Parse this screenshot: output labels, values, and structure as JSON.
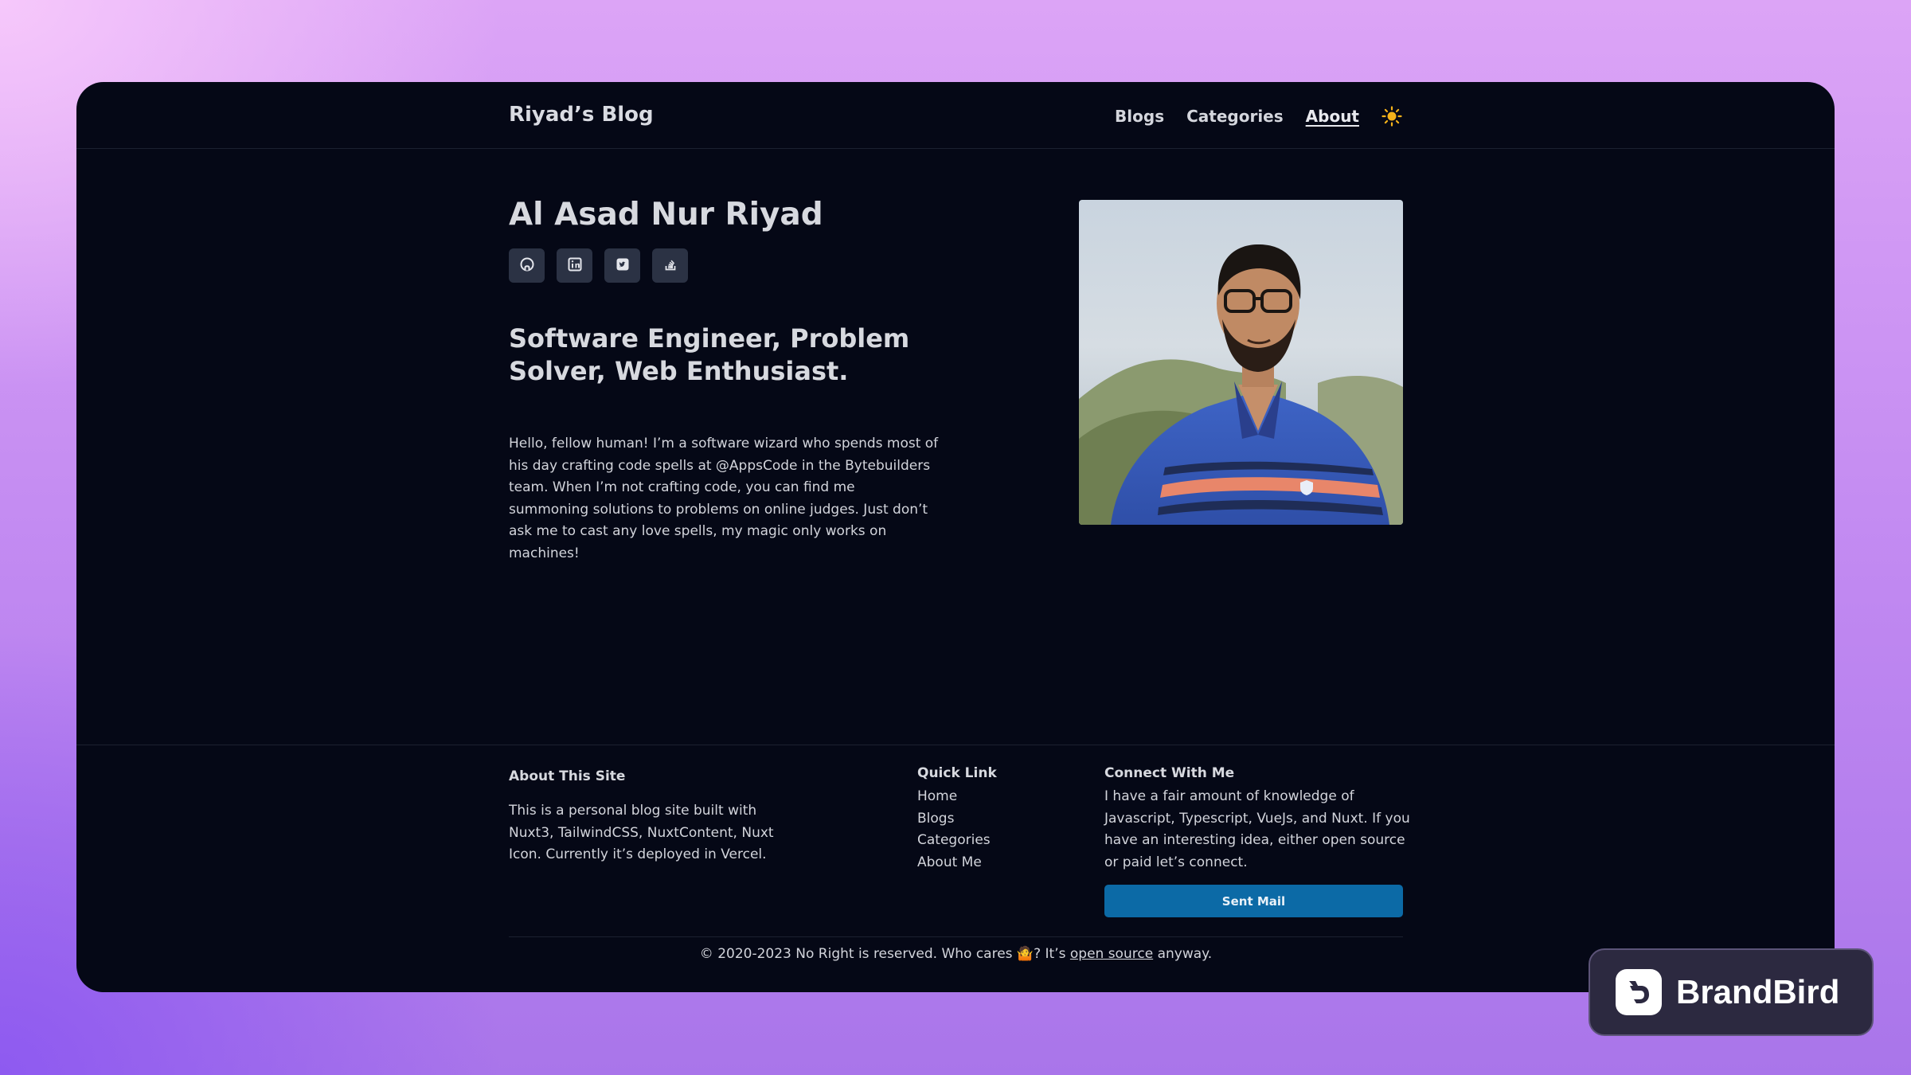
{
  "header": {
    "brand": "Riyad’s Blog",
    "nav": [
      {
        "label": "Blogs"
      },
      {
        "label": "Categories"
      },
      {
        "label": "About"
      }
    ],
    "theme_toggle_icon": "sun-icon"
  },
  "profile": {
    "name": "Al Asad Nur Riyad",
    "socials": [
      {
        "icon": "github-icon"
      },
      {
        "icon": "linkedin-icon"
      },
      {
        "icon": "twitter-icon"
      },
      {
        "icon": "stackoverflow-icon"
      }
    ],
    "tagline": "Software Engineer, Problem Solver, Web Enthusiast.",
    "bio": "Hello, fellow human! I’m a software wizard who spends most of his day crafting code spells at @AppsCode in the Bytebuilders team. When I’m not crafting code, you can find me summoning solutions to problems on online judges. Just don’t ask me to cast any love spells, my magic only works on machines!"
  },
  "footer": {
    "about_title": "About This Site",
    "about_text": "This is a personal blog site built with Nuxt3, TailwindCSS, NuxtContent, Nuxt Icon. Currently it’s deployed in Vercel.",
    "quick_title": "Quick Link",
    "quick_links": [
      "Home",
      "Blogs",
      "Categories",
      "About Me"
    ],
    "connect_title": "Connect With Me",
    "connect_text": "I have a fair amount of knowledge of Javascript, Typescript, VueJs, and Nuxt. If you have an interesting idea, either open source or paid let’s connect.",
    "mail_button": "Sent Mail",
    "copyright_prefix": "© 2020-2023 No Right is reserved. Who cares 🤷? It’s ",
    "copyright_link": "open source",
    "copyright_suffix": " anyway."
  },
  "watermark": {
    "label": "BrandBird"
  },
  "colors": {
    "window_bg": "#050816",
    "button_bg": "#0c6aa6",
    "social_bg": "#2b3244",
    "sun": "#f5b21a"
  }
}
